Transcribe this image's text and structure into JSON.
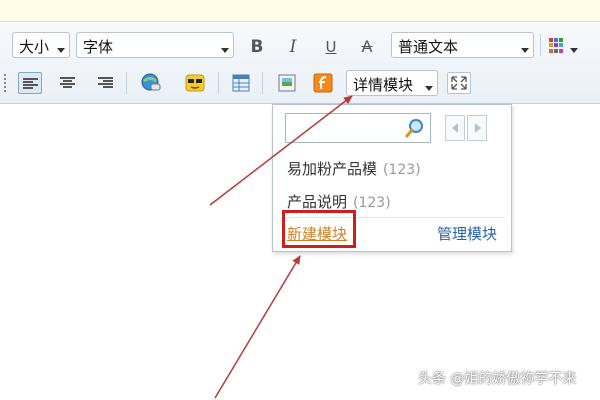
{
  "toolbar": {
    "size_label": "大小",
    "font_label": "字体",
    "bold_label": "B",
    "italic_label": "I",
    "underline_label": "U",
    "strike_label": "A",
    "paragraph_style": "普通文本",
    "template_button_label": "详情模块"
  },
  "template_dropdown": {
    "search_value": "",
    "items": [
      {
        "name": "易加粉产品模",
        "count": "(123)"
      },
      {
        "name": "产品说明",
        "count": "(123)"
      }
    ],
    "new_template_label": "新建模块",
    "manage_template_label": "管理模块"
  },
  "watermark": "头条 @姐的娇傲祢学不来",
  "colors": {
    "highlight_box": "#cc1f1f",
    "arrow": "#b83a3a",
    "link_orange": "#d4822a",
    "link_blue": "#2a63b0"
  },
  "icons": [
    "align-left-icon",
    "align-center-icon",
    "align-right-icon",
    "link-icon",
    "emoticon-icon",
    "table-icon",
    "image-icon",
    "flash-icon",
    "fullscreen-icon",
    "color-grid-icon",
    "search-icon"
  ]
}
